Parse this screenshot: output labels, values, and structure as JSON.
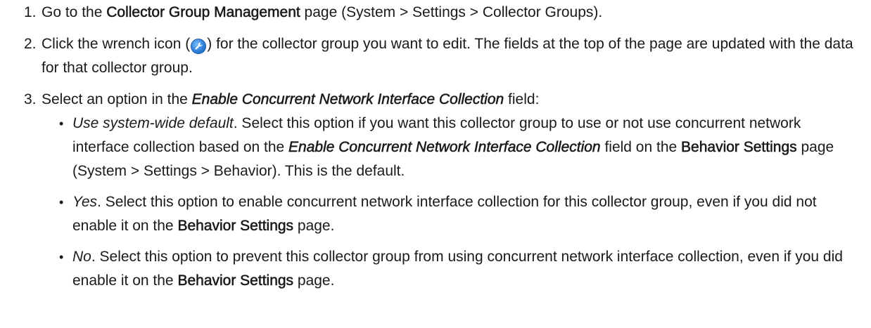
{
  "steps": [
    {
      "num": "1.",
      "parts": [
        "Go to the ",
        "Collector Group Management",
        " page (System > Settings > Collector Groups)."
      ]
    },
    {
      "num": "2.",
      "parts": [
        "Click the wrench icon (",
        ") for the collector group you want to edit. The fields at the top of the page are updated with the data for that collector group."
      ],
      "icon": "wrench-icon"
    },
    {
      "num": "3.",
      "parts": [
        "Select an option in the ",
        "Enable Concurrent Network Interface Collection",
        " field:"
      ],
      "options": [
        {
          "bullet": "•",
          "name": "Use system-wide default",
          "parts": [
            ". Select this option if you want this collector group to use or not use concurrent network interface collection based on the ",
            "Enable Concurrent Network Interface Collection",
            " field on the ",
            "Behavior Settings",
            " page (System > Settings > Behavior). This is the default."
          ]
        },
        {
          "bullet": "•",
          "name": "Yes",
          "parts": [
            ". Select this option to enable concurrent network interface collection for this collector group, even if you did not enable it on the ",
            "Behavior Settings",
            " page."
          ]
        },
        {
          "bullet": "•",
          "name": "No",
          "parts": [
            ". Select this option to prevent this collector group from using concurrent network interface collection, even if you did enable it on the ",
            "Behavior Settings",
            " page."
          ]
        }
      ]
    }
  ],
  "colors": {
    "text": "#1a1a1a",
    "icon_blue": "#2e7fd9"
  }
}
